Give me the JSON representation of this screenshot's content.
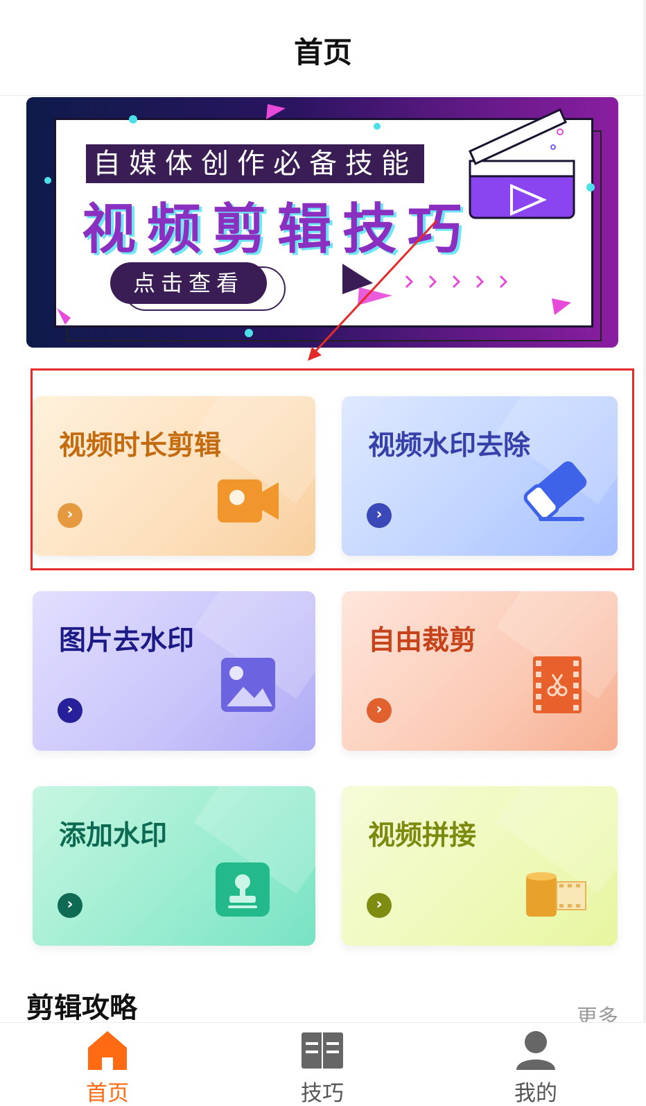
{
  "header": {
    "title": "首页"
  },
  "banner": {
    "tagline": "自媒体创作必备技能",
    "headline": "视频剪辑技巧",
    "cta_label": "点击查看"
  },
  "tools": [
    {
      "label": "视频时长剪辑",
      "icon": "video-camera-icon",
      "accent": "#c46a0f"
    },
    {
      "label": "视频水印去除",
      "icon": "eraser-icon",
      "accent": "#3540a8"
    },
    {
      "label": "图片去水印",
      "icon": "image-icon",
      "accent": "#1c1a86"
    },
    {
      "label": "自由裁剪",
      "icon": "film-scissors-icon",
      "accent": "#c6421a"
    },
    {
      "label": "添加水印",
      "icon": "stamp-icon",
      "accent": "#0d6a52"
    },
    {
      "label": "视频拼接",
      "icon": "film-reel-icon",
      "accent": "#7c8a0f"
    }
  ],
  "section": {
    "title": "剪辑攻略",
    "more_label": "更多"
  },
  "tabbar": {
    "items": [
      {
        "label": "首页",
        "icon": "home-icon",
        "active": true
      },
      {
        "label": "技巧",
        "icon": "book-icon",
        "active": false
      },
      {
        "label": "我的",
        "icon": "user-icon",
        "active": false
      }
    ],
    "active_color": "#ff6a13",
    "inactive_color": "#555555"
  },
  "annotation": {
    "highlight_color": "#e52a2a"
  }
}
